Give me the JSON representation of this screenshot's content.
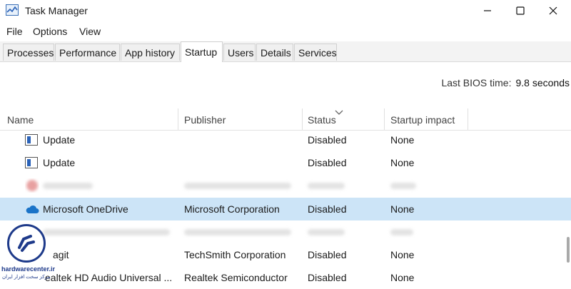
{
  "window": {
    "title": "Task Manager",
    "controls": [
      "minimize",
      "maximize",
      "close"
    ]
  },
  "menu": [
    "File",
    "Options",
    "View"
  ],
  "tabs": [
    {
      "label": "Processes",
      "active": false
    },
    {
      "label": "Performance",
      "active": false
    },
    {
      "label": "App history",
      "active": false
    },
    {
      "label": "Startup",
      "active": true
    },
    {
      "label": "Users",
      "active": false
    },
    {
      "label": "Details",
      "active": false
    },
    {
      "label": "Services",
      "active": false
    }
  ],
  "bios": {
    "label": "Last BIOS time:",
    "value": "9.8 seconds"
  },
  "columns": {
    "name": "Name",
    "publisher": "Publisher",
    "status": "Status",
    "impact": "Startup impact"
  },
  "rows": [
    {
      "name": "Update",
      "publisher": "",
      "status": "Disabled",
      "impact": "None",
      "icon": "window-app-icon"
    },
    {
      "name": "Update",
      "publisher": "",
      "status": "Disabled",
      "impact": "None",
      "icon": "window-app-icon"
    },
    {
      "name": "",
      "publisher": "",
      "status": "",
      "impact": "",
      "blurred": true,
      "icon": "red-app-icon"
    },
    {
      "name": "Microsoft OneDrive",
      "publisher": "Microsoft Corporation",
      "status": "Disabled",
      "impact": "None",
      "icon": "onedrive-cloud-icon",
      "selected": true
    },
    {
      "name": "",
      "publisher": "",
      "status": "",
      "impact": "",
      "blurred": true
    },
    {
      "name": "agit",
      "publisher": "TechSmith Corporation",
      "status": "Disabled",
      "impact": "None"
    },
    {
      "name": "ealtek HD Audio Universal ...",
      "publisher": "Realtek Semiconductor",
      "status": "Disabled",
      "impact": "None"
    }
  ],
  "watermark": {
    "site": "hardwarecenter.ir",
    "tagline": "مرکز سخت افزار ایران"
  },
  "colors": {
    "selection": "#cce4f7",
    "onedrive": "#1a73c8",
    "watermark": "#1e3a8a"
  }
}
